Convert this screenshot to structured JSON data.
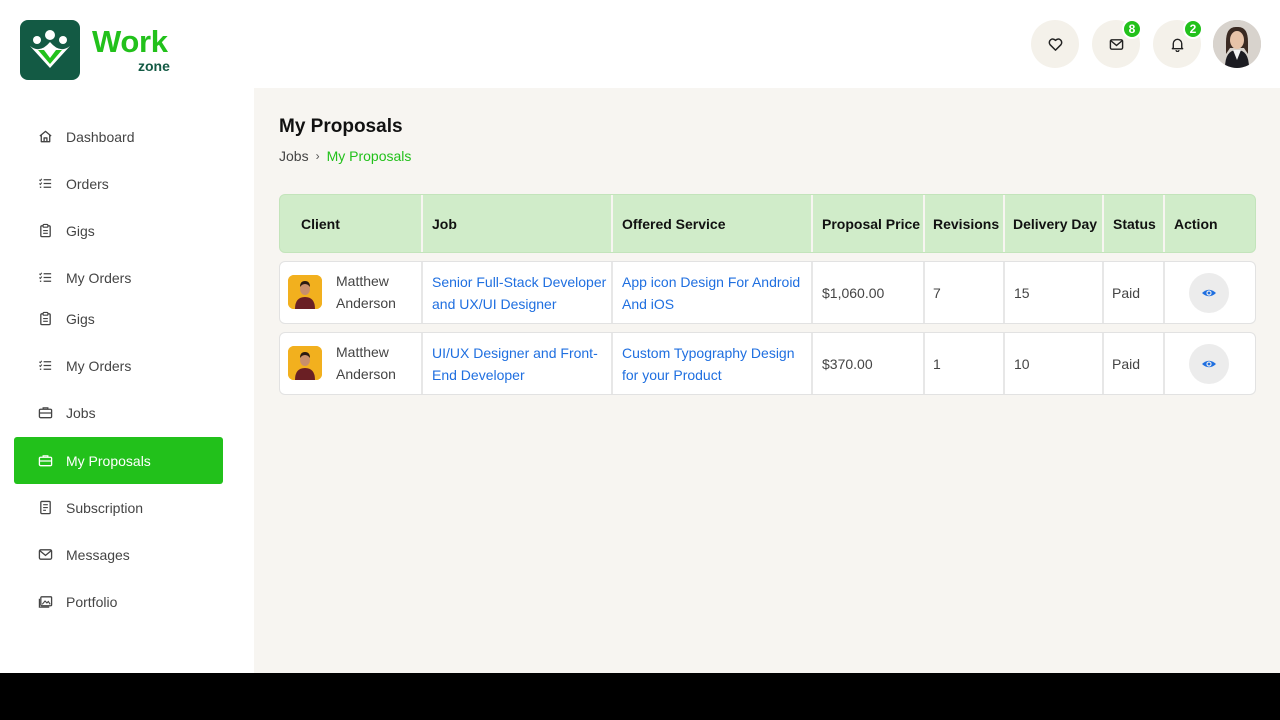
{
  "brand": {
    "word1": "Work",
    "word2": "zone"
  },
  "header": {
    "messages_count": "8",
    "notifications_count": "2"
  },
  "colors": {
    "accent": "#22c11b",
    "brand_dark": "#135a44",
    "link": "#1f6fe0",
    "table_header": "#d0ecc9"
  },
  "sidebar": {
    "items": [
      {
        "label": "Dashboard",
        "icon": "home-icon"
      },
      {
        "label": "Orders",
        "icon": "list-icon"
      },
      {
        "label": "Gigs",
        "icon": "clipboard-icon"
      },
      {
        "label": "My Orders",
        "icon": "list-icon"
      },
      {
        "label": "Gigs",
        "icon": "clipboard-icon"
      },
      {
        "label": "My Orders",
        "icon": "list-icon"
      },
      {
        "label": "Jobs",
        "icon": "briefcase-icon"
      },
      {
        "label": "My Proposals",
        "icon": "briefcase-icon",
        "active": true
      },
      {
        "label": "Subscription",
        "icon": "receipt-icon"
      },
      {
        "label": "Messages",
        "icon": "envelope-icon"
      },
      {
        "label": "Portfolio",
        "icon": "image-icon"
      }
    ]
  },
  "main": {
    "title": "My Proposals",
    "breadcrumb": {
      "home": "Jobs",
      "separator": "›",
      "current": "My Proposals"
    }
  },
  "table": {
    "columns": [
      "Client",
      "Job",
      "Offered Service",
      "Proposal Price",
      "Revisions",
      "Delivery Day",
      "Status",
      "Action"
    ],
    "rows": [
      {
        "client_first": "Matthew",
        "client_last": "Anderson",
        "job_line1": "Senior Full-Stack Developer",
        "job_line2": "and UX/UI Designer",
        "service_line1": "App icon Design For Android",
        "service_line2": "And iOS",
        "price": "$1,060.00",
        "revisions": "7",
        "delivery": "15",
        "status": "Paid"
      },
      {
        "client_first": "Matthew",
        "client_last": "Anderson",
        "job_line1": "UI/UX Designer and Front-",
        "job_line2": "End Developer",
        "service_line1": "Custom Typography Design",
        "service_line2": "for your Product",
        "price": "$370.00",
        "revisions": "1",
        "delivery": "10",
        "status": "Paid"
      }
    ]
  }
}
